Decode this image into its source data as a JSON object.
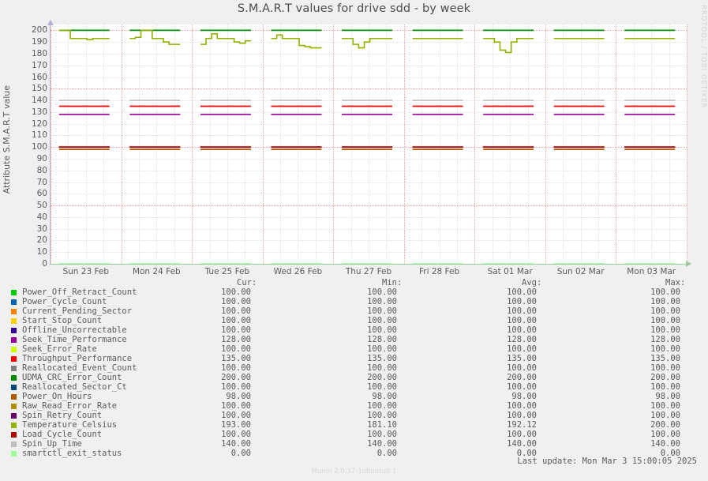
{
  "title": "S.M.A.R.T values for drive sdd - by week",
  "watermark": "RRDTOOL / TOBI OETIKER",
  "footer": {
    "last_update": "Last update: Mon Mar  3 15:00:05 2025",
    "version": "Munin 2.0.37-1ubuntu0.1"
  },
  "legend_headers": {
    "cur": "Cur:",
    "min": "Min:",
    "avg": "Avg:",
    "max": "Max:"
  },
  "series": [
    {
      "label": "Power_Off_Retract_Count",
      "color": "#00cc00",
      "cur": "100.00",
      "min": "100.00",
      "avg": "100.00",
      "max": "100.00",
      "value": 100
    },
    {
      "label": "Power_Cycle_Count",
      "color": "#0066b3",
      "cur": "100.00",
      "min": "100.00",
      "avg": "100.00",
      "max": "100.00",
      "value": 100
    },
    {
      "label": "Current_Pending_Sector",
      "color": "#ff8000",
      "cur": "100.00",
      "min": "100.00",
      "avg": "100.00",
      "max": "100.00",
      "value": 100
    },
    {
      "label": "Start_Stop_Count",
      "color": "#ffcc00",
      "cur": "100.00",
      "min": "100.00",
      "avg": "100.00",
      "max": "100.00",
      "value": 100
    },
    {
      "label": "Offline_Uncorrectable",
      "color": "#330099",
      "cur": "100.00",
      "min": "100.00",
      "avg": "100.00",
      "max": "100.00",
      "value": 100
    },
    {
      "label": "Seek_Time_Performance",
      "color": "#990099",
      "cur": "128.00",
      "min": "128.00",
      "avg": "128.00",
      "max": "128.00",
      "value": 128
    },
    {
      "label": "Seek_Error_Rate",
      "color": "#ccff00",
      "cur": "100.00",
      "min": "100.00",
      "avg": "100.00",
      "max": "100.00",
      "value": 100
    },
    {
      "label": "Throughput_Performance",
      "color": "#ff0000",
      "cur": "135.00",
      "min": "135.00",
      "avg": "135.00",
      "max": "135.00",
      "value": 135
    },
    {
      "label": "Reallocated_Event_Count",
      "color": "#808080",
      "cur": "100.00",
      "min": "100.00",
      "avg": "100.00",
      "max": "100.00",
      "value": 100
    },
    {
      "label": "UDMA_CRC_Error_Count",
      "color": "#008f00",
      "cur": "200.00",
      "min": "200.00",
      "avg": "200.00",
      "max": "200.00",
      "value": 200
    },
    {
      "label": "Reallocated_Sector_Ct",
      "color": "#00487d",
      "cur": "100.00",
      "min": "100.00",
      "avg": "100.00",
      "max": "100.00",
      "value": 100
    },
    {
      "label": "Power_On_Hours",
      "color": "#b35a00",
      "cur": "98.00",
      "min": "98.00",
      "avg": "98.00",
      "max": "98.00",
      "value": 98
    },
    {
      "label": "Raw_Read_Error_Rate",
      "color": "#b38f00",
      "cur": "100.00",
      "min": "100.00",
      "avg": "100.00",
      "max": "100.00",
      "value": 100
    },
    {
      "label": "Spin_Retry_Count",
      "color": "#6b006b",
      "cur": "100.00",
      "min": "100.00",
      "avg": "100.00",
      "max": "100.00",
      "value": 100
    },
    {
      "label": "Temperature_Celsius",
      "color": "#8fb300",
      "cur": "193.00",
      "min": "181.10",
      "avg": "192.12",
      "max": "200.00",
      "value": 193
    },
    {
      "label": "Load_Cycle_Count",
      "color": "#b30000",
      "cur": "100.00",
      "min": "100.00",
      "avg": "100.00",
      "max": "100.00",
      "value": 100
    },
    {
      "label": "Spin_Up_Time",
      "color": "#bfbfbf",
      "cur": "140.00",
      "min": "140.00",
      "avg": "140.00",
      "max": "140.00",
      "value": 140
    },
    {
      "label": "smartctl_exit_status",
      "color": "#99ff99",
      "cur": "0.00",
      "min": "0.00",
      "avg": "0.00",
      "max": "0.00",
      "value": 0
    }
  ],
  "chart_data": {
    "type": "line",
    "title": "S.M.A.R.T values for drive sdd - by week",
    "xlabel": "",
    "ylabel": "Attribute S.M.A.R.T value",
    "ylim": [
      0,
      205
    ],
    "yticks": [
      0,
      10,
      20,
      30,
      40,
      50,
      60,
      70,
      80,
      90,
      100,
      110,
      120,
      130,
      140,
      150,
      160,
      170,
      180,
      190,
      200
    ],
    "grid": true,
    "legend_position": "below",
    "x_tick_labels": [
      "Sun 23 Feb",
      "Mon 24 Feb",
      "Tue 25 Feb",
      "Wed 26 Feb",
      "Thu 27 Feb",
      "Fri 28 Feb",
      "Sat 01 Mar",
      "Sun 02 Mar",
      "Mon 03 Mar"
    ],
    "note": "Data is drawn as 9 gapped daily segments; most attributes are flat constant lines, Temperature_Celsius fluctuates between 181 and 200.",
    "constant_series": [
      {
        "name": "UDMA_CRC_Error_Count",
        "value": 200,
        "color": "#008f00"
      },
      {
        "name": "Spin_Up_Time",
        "value": 140,
        "color": "#bfbfbf"
      },
      {
        "name": "Throughput_Performance",
        "value": 135,
        "color": "#ff0000"
      },
      {
        "name": "Seek_Time_Performance",
        "value": 128,
        "color": "#990099"
      },
      {
        "name": "Load_Cycle_Count",
        "value": 100,
        "color": "#b30000"
      },
      {
        "name": "Power_On_Hours",
        "value": 98,
        "color": "#b35a00"
      },
      {
        "name": "smartctl_exit_status",
        "value": 0,
        "color": "#99ff99"
      }
    ],
    "temperature_series": {
      "name": "Temperature_Celsius",
      "color": "#8fb300",
      "ylim_values": [
        181,
        200
      ],
      "segments": [
        {
          "day": "Sun 23 Feb",
          "points": [
            200,
            200,
            193,
            193,
            193,
            192,
            193,
            193,
            193
          ]
        },
        {
          "day": "Mon 24 Feb",
          "points": [
            193,
            194,
            200,
            200,
            193,
            193,
            190,
            188,
            188
          ]
        },
        {
          "day": "Tue 25 Feb",
          "points": [
            188,
            193,
            197,
            193,
            193,
            193,
            190,
            189,
            191
          ]
        },
        {
          "day": "Wed 26 Feb",
          "points": [
            193,
            196,
            193,
            193,
            193,
            187,
            186,
            185,
            185
          ]
        },
        {
          "day": "Thu 27 Feb",
          "points": [
            193,
            193,
            188,
            185,
            190,
            193,
            193,
            193,
            193
          ]
        },
        {
          "day": "Fri 28 Feb",
          "points": [
            193,
            193,
            193,
            193,
            193,
            193,
            193,
            193,
            193
          ]
        },
        {
          "day": "Sat 01 Mar",
          "points": [
            193,
            193,
            190,
            183,
            181,
            190,
            193,
            193,
            193
          ]
        },
        {
          "day": "Sun 02 Mar",
          "points": [
            193,
            193,
            193,
            193,
            193,
            193,
            193,
            193,
            193
          ]
        },
        {
          "day": "Mon 03 Mar",
          "points": [
            193,
            193,
            193,
            193,
            193,
            193,
            193,
            193,
            193
          ]
        }
      ]
    }
  }
}
